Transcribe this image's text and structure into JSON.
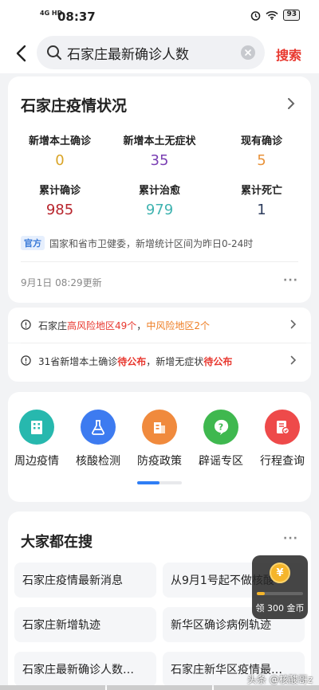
{
  "status_bar": {
    "network": "4G HD",
    "time": "08:37",
    "battery": "93"
  },
  "search": {
    "query": "石家庄最新确诊人数",
    "submit_label": "搜索"
  },
  "overview": {
    "title": "石家庄疫情状况",
    "stats": [
      {
        "label": "新增本土确诊",
        "value": "0",
        "color": "#d9a426"
      },
      {
        "label": "新增本土无症状",
        "value": "35",
        "color": "#7a3fb3"
      },
      {
        "label": "现有确诊",
        "value": "5",
        "color": "#e8923a"
      },
      {
        "label": "累计确诊",
        "value": "985",
        "color": "#b8242c"
      },
      {
        "label": "累计治愈",
        "value": "979",
        "color": "#3fb3b0"
      },
      {
        "label": "累计死亡",
        "value": "1",
        "color": "#2c3b5c"
      }
    ],
    "source_tag": "官方",
    "source_text": "国家和省市卫健委，新增统计区间为昨日0-24时",
    "updated": "9月1日 08:29更新",
    "more": "···"
  },
  "alerts": [
    {
      "parts": [
        "石家庄",
        "高风险地区49个",
        "，",
        "中风险地区2个"
      ],
      "colors": [
        "#333",
        "#e8382f",
        "#333",
        "#ee7d22"
      ]
    },
    {
      "parts": [
        "31省新增本土确诊",
        "待公布",
        "，新增无症状",
        "待公布"
      ],
      "colors": [
        "#333",
        "#e8382f",
        "#333",
        "#e8382f"
      ]
    }
  ],
  "services": [
    {
      "label": "周边疫情",
      "icon": "building-icon",
      "color": "#27b8ae"
    },
    {
      "label": "核酸检测",
      "icon": "flask-icon",
      "color": "#3d7bf0"
    },
    {
      "label": "防疫政策",
      "icon": "policy-icon",
      "color": "#f08a3d"
    },
    {
      "label": "辟谣专区",
      "icon": "question-icon",
      "color": "#3fb84f"
    },
    {
      "label": "行程查询",
      "icon": "itinerary-icon",
      "color": "#ee4a4a"
    }
  ],
  "trending": {
    "title": "大家都在搜",
    "more": "···",
    "items": [
      "石家庄疫情最新消息",
      "从9月1号起不做核酸",
      "石家庄新增轨迹",
      "新华区确诊病例轨迹",
      "石家庄最新确诊人数…",
      "石家庄新华区疫情最…"
    ]
  },
  "coin_widget": {
    "symbol": "¥",
    "text": "领 300 金币",
    "progress": 0.17
  },
  "watermark": "头条 @核酸哥z",
  "colors": {
    "accent_red": "#e8382f",
    "page_bg": "#f2f3f5"
  }
}
